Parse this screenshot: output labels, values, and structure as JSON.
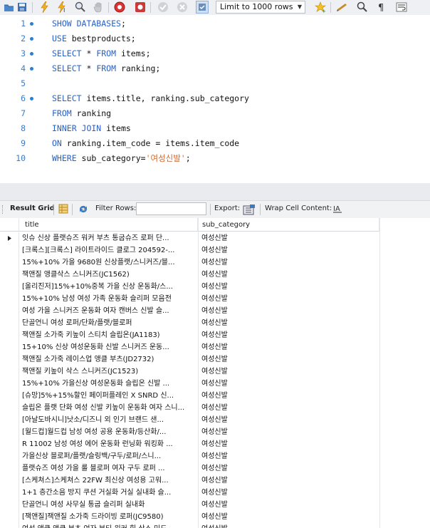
{
  "toolbar": {
    "limit_label": "Limit to 1000 rows"
  },
  "editor": {
    "lines": [
      {
        "n": "1",
        "dot": true,
        "segments": [
          {
            "t": "SHOW DATABASES",
            "k": true
          },
          {
            "t": ";",
            "k": false
          }
        ]
      },
      {
        "n": "2",
        "dot": true,
        "segments": [
          {
            "t": "USE",
            "k": true
          },
          {
            "t": " bestproducts;",
            "k": false
          }
        ]
      },
      {
        "n": "3",
        "dot": true,
        "segments": [
          {
            "t": "SELECT",
            "k": true
          },
          {
            "t": " * ",
            "k": false
          },
          {
            "t": "FROM",
            "k": true
          },
          {
            "t": " items;",
            "k": false
          }
        ]
      },
      {
        "n": "4",
        "dot": true,
        "segments": [
          {
            "t": "SELECT",
            "k": true
          },
          {
            "t": " * ",
            "k": false
          },
          {
            "t": "FROM",
            "k": true
          },
          {
            "t": " ranking;",
            "k": false
          }
        ]
      },
      {
        "n": "5",
        "dot": false,
        "segments": []
      },
      {
        "n": "6",
        "dot": true,
        "segments": [
          {
            "t": "SELECT",
            "k": true
          },
          {
            "t": " items.title, ranking.sub_category",
            "k": false
          }
        ]
      },
      {
        "n": "7",
        "dot": false,
        "segments": [
          {
            "t": "FROM",
            "k": true
          },
          {
            "t": " ranking",
            "k": false
          }
        ]
      },
      {
        "n": "8",
        "dot": false,
        "segments": [
          {
            "t": "INNER JOIN",
            "k": true
          },
          {
            "t": " items",
            "k": false
          }
        ]
      },
      {
        "n": "9",
        "dot": false,
        "segments": [
          {
            "t": "ON",
            "k": true
          },
          {
            "t": " ranking.item_code = items.item_code",
            "k": false
          }
        ]
      },
      {
        "n": "10",
        "dot": false,
        "segments": [
          {
            "t": "WHERE",
            "k": true
          },
          {
            "t": " sub_category=",
            "k": false
          },
          {
            "t": "'여성신발'",
            "s": true
          },
          {
            "t": ";",
            "k": false
          }
        ]
      }
    ]
  },
  "result_bar": {
    "result_grid": "Result Grid",
    "filter_rows": "Filter Rows:",
    "export": "Export:",
    "wrap": "Wrap Cell Content:"
  },
  "grid": {
    "columns": [
      "title",
      "sub_category"
    ],
    "rows": [
      [
        "잇슈 신상 플랫슈즈 워커 부츠 통굽슈즈 로퍼 단...",
        "여성신발"
      ],
      [
        "[크록스][크록스] 라이트라이드 클로그 204592-...",
        "여성신발"
      ],
      [
        "15%+10% 가을 9680원 신상플랫/스니커즈/블...",
        "여성신발"
      ],
      [
        "잭앤질 앵클삭스 스니커즈(JC1562)",
        "여성신발"
      ],
      [
        "[올리진저]15%+10%중복 가을 신상 운동화/스...",
        "여성신발"
      ],
      [
        "15%+10% 남성 여성 가족 운동화 슬리퍼 모음전",
        "여성신발"
      ],
      [
        "여성 가을 스니커즈 운동화 여자 캔버스 신발 슬...",
        "여성신발"
      ],
      [
        "단골언니 여성 로퍼/단화/플랫/블로퍼",
        "여성신발"
      ],
      [
        "잭앤질 소가죽 키높이 스티치 슬립온(JA1183)",
        "여성신발"
      ],
      [
        "15+10% 신상 여성운동화 신발 스니커즈 운동...",
        "여성신발"
      ],
      [
        "잭앤질 소가죽 레이스업 앵클 부츠(JD2732)",
        "여성신발"
      ],
      [
        "잭앤질 키높이 삭스 스니커즈(JC1523)",
        "여성신발"
      ],
      [
        "15%+10% 가을신상 여성운동화 슬립온 신발 ...",
        "여성신발"
      ],
      [
        "[슈망]5%+15%할인 페이퍼플레인 X SNRD 신...",
        "여성신발"
      ],
      [
        "슬립온 플랫 단화 여성 신발 키높이 운동화 여자 스니...",
        "여성신발"
      ],
      [
        "[아날도바시니]낫소/디즈니 외 인기 브랜드 샌...",
        "여성신발"
      ],
      [
        "[월드컵]월드컵 남성 여성 공용 운동화/등산화/...",
        "여성신발"
      ],
      [
        "R 11002 남성 여성 에어 운동화 런닝화 워킹화 ...",
        "여성신발"
      ],
      [
        "가을신상 블로퍼/플랫/슬링백/구두/로퍼/스니...",
        "여성신발"
      ],
      [
        "플랫슈즈 여성 가을 룰 블로퍼 여자 구두 로퍼 ...",
        "여성신발"
      ],
      [
        "[스케쳐스]스케쳐스 22FW 최신상 여성용 고워...",
        "여성신발"
      ],
      [
        "1+1 층간소음 방지 쿠션 거실화 거실 실내화 슬...",
        "여성신발"
      ],
      [
        "단골언니 여성 사무실 통굽 슬리퍼 실내화",
        "여성신발"
      ],
      [
        "[잭앤질]잭앤질 소가죽 드라이빙 로퍼(JC9580)",
        "여성신발"
      ],
      [
        "여성 앵클 앵클 부츠 여자 부티 워커 힐 삭스 미드...",
        "여성신발"
      ]
    ]
  }
}
